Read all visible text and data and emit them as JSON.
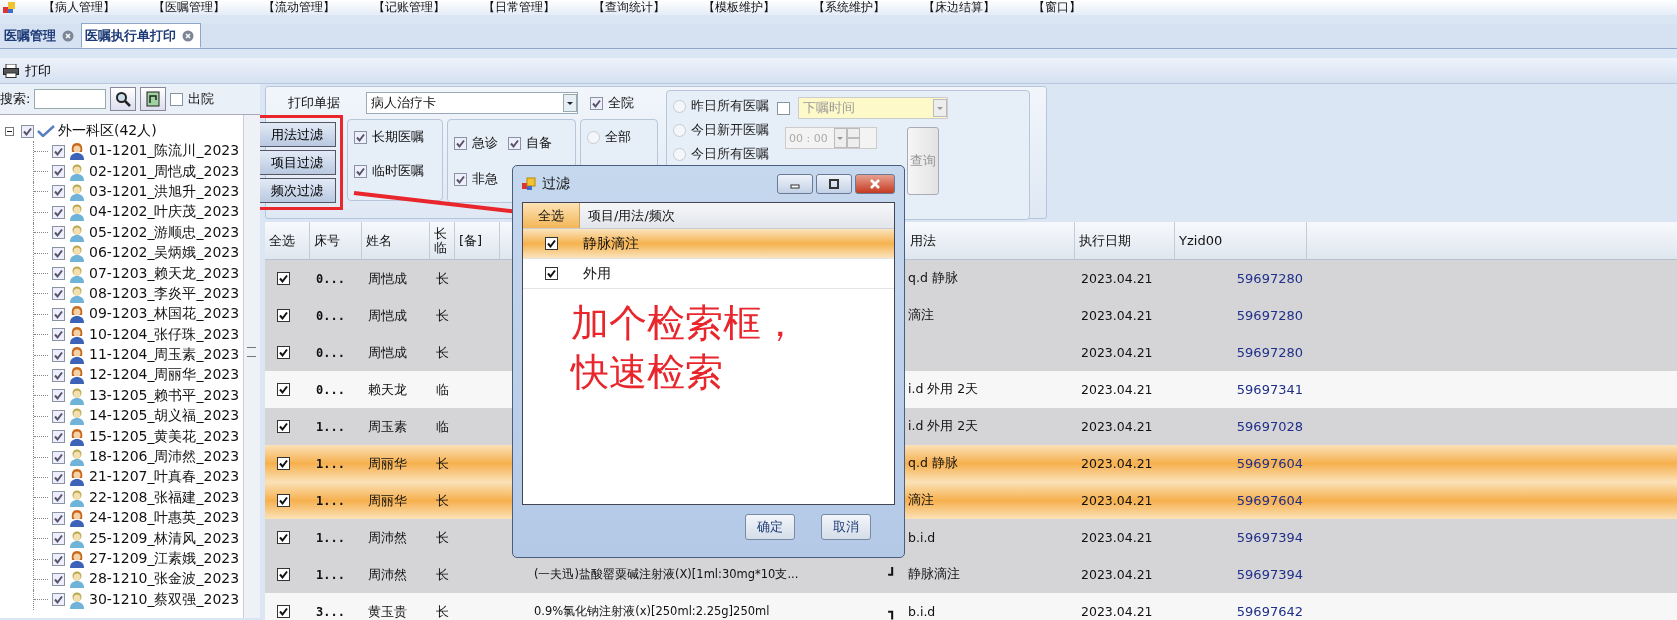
{
  "menu": [
    "【病人管理】",
    "【医嘱管理】",
    "【流动管理】",
    "【记账管理】",
    "【日常管理】",
    "【查询统计】",
    "【模板维护】",
    "【系统维护】",
    "【床边结算】",
    "【窗口】"
  ],
  "tabs": [
    {
      "label": "医嘱管理",
      "selected": false
    },
    {
      "label": "医嘱执行单打印",
      "selected": true
    }
  ],
  "toolbar": {
    "print_label": "打印"
  },
  "sidebar": {
    "search_label": "搜索:",
    "discharged": {
      "label": "出院",
      "checked": false
    },
    "tree": {
      "label": "外一科区(42人)",
      "checked": true,
      "expanded": true,
      "children": [
        {
          "label": "01-1201_陈流川_2023",
          "checked": true,
          "kind": "female"
        },
        {
          "label": "02-1201_周恺成_2023",
          "checked": true,
          "kind": "male"
        },
        {
          "label": "03-1201_洪旭升_2023",
          "checked": true,
          "kind": "male"
        },
        {
          "label": "04-1202_叶庆茂_2023",
          "checked": true,
          "kind": "male"
        },
        {
          "label": "05-1202_游顺忠_2023",
          "checked": true,
          "kind": "male"
        },
        {
          "label": "06-1202_吴炳娥_2023",
          "checked": true,
          "kind": "male"
        },
        {
          "label": "07-1203_赖天龙_2023",
          "checked": true,
          "kind": "male"
        },
        {
          "label": "08-1203_李炎平_2023",
          "checked": true,
          "kind": "male"
        },
        {
          "label": "09-1203_林国花_2023",
          "checked": true,
          "kind": "female"
        },
        {
          "label": "10-1204_张仔珠_2023",
          "checked": true,
          "kind": "female"
        },
        {
          "label": "11-1204_周玉素_2023",
          "checked": true,
          "kind": "female"
        },
        {
          "label": "12-1204_周丽华_2023",
          "checked": true,
          "kind": "female"
        },
        {
          "label": "13-1205_赖书平_2023",
          "checked": true,
          "kind": "male"
        },
        {
          "label": "14-1205_胡义福_2023",
          "checked": true,
          "kind": "male"
        },
        {
          "label": "15-1205_黄美花_2023",
          "checked": true,
          "kind": "female"
        },
        {
          "label": "18-1206_周沛然_2023",
          "checked": true,
          "kind": "male"
        },
        {
          "label": "21-1207_叶真春_2023",
          "checked": true,
          "kind": "female"
        },
        {
          "label": "22-1208_张福建_2023",
          "checked": true,
          "kind": "male"
        },
        {
          "label": "24-1208_叶惠英_2023",
          "checked": true,
          "kind": "female"
        },
        {
          "label": "25-1209_林清风_2023",
          "checked": true,
          "kind": "male"
        },
        {
          "label": "27-1209_江素娥_2023",
          "checked": true,
          "kind": "female"
        },
        {
          "label": "28-1210_张金波_2023",
          "checked": true,
          "kind": "male"
        },
        {
          "label": "30-1210_蔡双强_2023",
          "checked": true,
          "kind": "male"
        }
      ]
    }
  },
  "print_options": {
    "doc_label": "打印单据",
    "doc_value": "病人治疗卡",
    "whole_hospital": {
      "label": "全院",
      "checked": true
    },
    "filter_buttons": [
      "用法过滤",
      "项目过滤",
      "频次过滤"
    ],
    "order_types": [
      {
        "label": "长期医嘱",
        "checked": true
      },
      {
        "label": "临时医嘱",
        "checked": true
      }
    ],
    "urgency": [
      {
        "label": "急诊",
        "checked": true
      },
      {
        "label": "自备",
        "checked": true
      },
      {
        "label": "非急",
        "checked": true
      }
    ],
    "scope": {
      "label": "全部",
      "selected": false
    },
    "periods": [
      {
        "label": "昨日所有医嘱",
        "selected": false
      },
      {
        "label": "今日新开医嘱",
        "selected": false
      },
      {
        "label": "今日所有医嘱",
        "selected": false
      }
    ],
    "time_filter": {
      "checked": false,
      "placeholder": "下嘱时间",
      "time": "00 : 00"
    },
    "query_button": "查询"
  },
  "table": {
    "columns": [
      "全选",
      "床号",
      "姓名",
      "长临",
      "[备]",
      "用法",
      "执行日期",
      "Yzid00"
    ],
    "rows": [
      {
        "checked": true,
        "bed": "0...",
        "name": "周恺成",
        "type": "长",
        "usage": "q.d 静脉",
        "date": "2023.04.21",
        "id": "59697280",
        "selected": false,
        "shaded": true
      },
      {
        "checked": true,
        "bed": "0...",
        "name": "周恺成",
        "type": "长",
        "usage": "滴注",
        "date": "2023.04.21",
        "id": "59697280",
        "selected": false,
        "shaded": true
      },
      {
        "checked": true,
        "bed": "0...",
        "name": "周恺成",
        "type": "长",
        "date": "2023.04.21",
        "id": "59697280",
        "selected": false,
        "shaded": true
      },
      {
        "checked": true,
        "bed": "0...",
        "name": "赖天龙",
        "type": "临",
        "usage": "i.d 外用 2天",
        "date": "2023.04.21",
        "id": "59697341",
        "selected": false,
        "shaded": false
      },
      {
        "checked": true,
        "bed": "1...",
        "name": "周玉素",
        "type": "临",
        "usage": "i.d 外用 2天",
        "date": "2023.04.21",
        "id": "59697028",
        "selected": false,
        "shaded": true
      },
      {
        "checked": true,
        "bed": "1...",
        "name": "周丽华",
        "type": "长",
        "usage": "q.d 静脉",
        "date": "2023.04.21",
        "id": "59697604",
        "selected": true,
        "shaded": false
      },
      {
        "checked": true,
        "bed": "1...",
        "name": "周丽华",
        "type": "长",
        "usage": "滴注",
        "date": "2023.04.21",
        "id": "59697604",
        "selected": true,
        "shaded": false
      },
      {
        "checked": true,
        "bed": "1...",
        "name": "周沛然",
        "type": "长",
        "usage": "b.i.d",
        "date": "2023.04.21",
        "id": "59697394",
        "selected": false,
        "shaded": true
      },
      {
        "checked": true,
        "bed": "1...",
        "name": "周沛然",
        "type": "长",
        "item": "(一夫迅)盐酸罂粟碱注射液(X)[1ml:30mg*10支...",
        "bracket": "┛",
        "usage": "静脉滴注",
        "date": "2023.04.21",
        "id": "59697394",
        "selected": false,
        "shaded": true
      },
      {
        "checked": true,
        "bed": "3...",
        "name": "黄玉贵",
        "type": "长",
        "item": "0.9%氯化钠注射液(x)[250ml:2.25g]250ml",
        "bracket": "┓",
        "usage": "b.i.d",
        "date": "2023.04.21",
        "id": "59697642",
        "selected": false,
        "shaded": false
      }
    ]
  },
  "dialog": {
    "title": "过滤",
    "columns": [
      "全选",
      "项目/用法/频次"
    ],
    "rows": [
      {
        "label": "静脉滴注",
        "checked": true,
        "selected": true
      },
      {
        "label": "外用",
        "checked": true,
        "selected": false
      }
    ],
    "buttons": [
      "确定",
      "取消"
    ]
  },
  "annotation": {
    "text": "加个检索框，快速检索"
  }
}
